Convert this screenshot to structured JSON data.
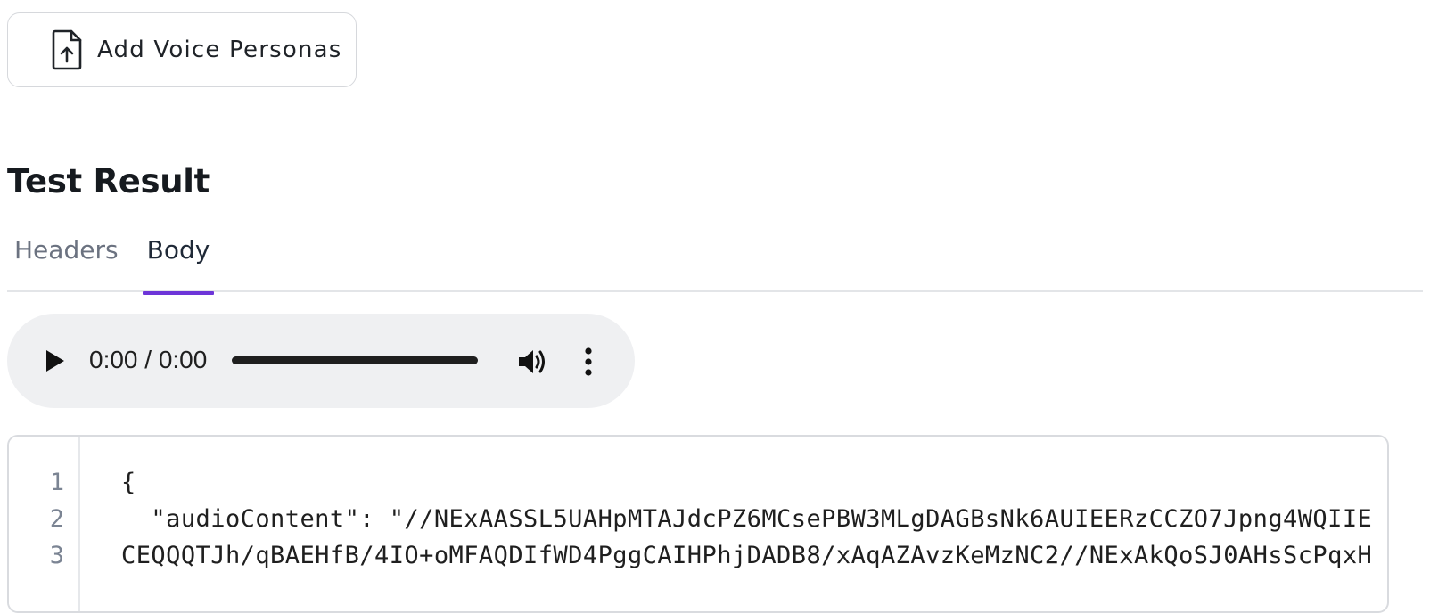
{
  "add_personas_button": {
    "label": "Add Voice Personas",
    "icon": "file-upload-icon"
  },
  "section": {
    "title": "Test Result"
  },
  "tabs": [
    {
      "label": "Headers",
      "active": false
    },
    {
      "label": "Body",
      "active": true
    }
  ],
  "tab_accent_color": "#6d35d8",
  "audio_player": {
    "time_display": "0:00 / 0:00",
    "play_icon": "play-icon",
    "volume_icon": "volume-icon",
    "menu_icon": "more-vertical-icon"
  },
  "code": {
    "line_numbers": [
      "1",
      "2",
      "3"
    ],
    "lines": [
      "{",
      "  \"audioContent\": \"//NExAASSL5UAHpMTAJdcPZ6MCsePBW3MLgDAGBsNk6AUIEERzCCZO7Jpng4WQIIE",
      "CEQQQTJh/qBAEHfB/4IO+oMFAQDIfWD4PggCAIHPhjDADB8/xAqAZAvzKeMzNC2//NExAkQoSJ0AHsScPqxH"
    ]
  }
}
